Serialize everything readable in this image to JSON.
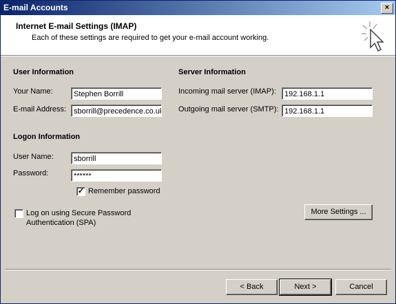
{
  "window": {
    "title": "E-mail Accounts",
    "close_glyph": "×"
  },
  "header": {
    "title": "Internet E-mail Settings (IMAP)",
    "subtitle": "Each of these settings are required to get your e-mail account working.",
    "icon": "cursor-sparkle-icon"
  },
  "user_info": {
    "heading": "User Information",
    "name_label": "Your Name:",
    "name_value": "Stephen Borrill",
    "email_label": "E-mail Address:",
    "email_value": "sborrill@precedence.co.uk"
  },
  "server_info": {
    "heading": "Server Information",
    "incoming_label": "Incoming mail server (IMAP):",
    "incoming_value": "192.168.1.1",
    "outgoing_label": "Outgoing mail server (SMTP):",
    "outgoing_value": "192.168.1.1"
  },
  "logon_info": {
    "heading": "Logon Information",
    "username_label": "User Name:",
    "username_value": "sborrill",
    "password_label": "Password:",
    "password_value": "******",
    "remember_label": "Remember password",
    "remember_checked": true,
    "remember_mark": "✓"
  },
  "spa": {
    "label_line1": "Log on using Secure Password",
    "label_line2": "Authentication (SPA)",
    "checked": false
  },
  "buttons": {
    "more_settings": "More Settings ...",
    "back": "< Back",
    "next": "Next >",
    "cancel": "Cancel"
  }
}
